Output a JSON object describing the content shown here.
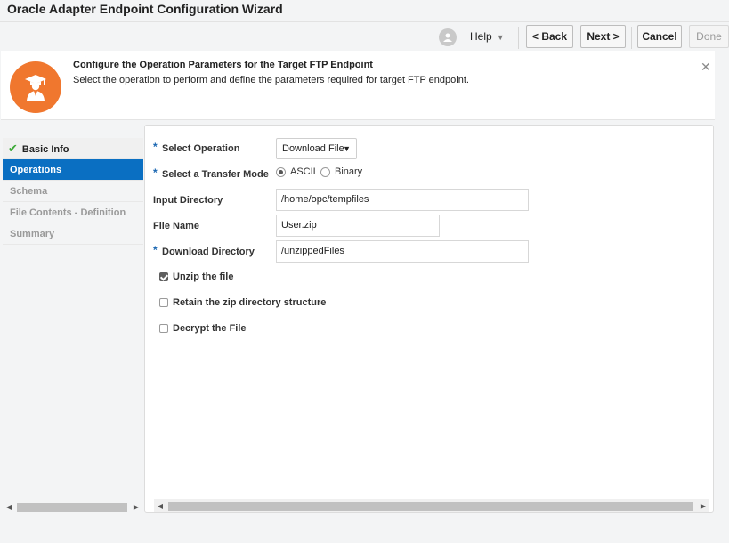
{
  "window": {
    "title": "Oracle Adapter Endpoint Configuration Wizard"
  },
  "toolbar": {
    "help_label": "Help",
    "back_label": "< Back",
    "next_label": "Next >",
    "cancel_label": "Cancel",
    "done_label": "Done",
    "user_avatar_icon": "user-badge-icon"
  },
  "banner": {
    "title": "Configure the Operation Parameters for the Target FTP Endpoint",
    "subtitle": "Select the operation to perform and define the parameters required for target FTP endpoint.",
    "icon": "graduate-user-icon",
    "icon_color": "#f0772e"
  },
  "nav": {
    "items": [
      {
        "label": "Basic Info",
        "state": "done"
      },
      {
        "label": "Operations",
        "state": "active"
      },
      {
        "label": "Schema",
        "state": "disabled"
      },
      {
        "label": "File Contents - Definition",
        "state": "disabled"
      },
      {
        "label": "Summary",
        "state": "disabled"
      }
    ],
    "active_color": "#0a6fc2"
  },
  "form": {
    "select_operation": {
      "label": "Select Operation",
      "value": "Download File",
      "required": true
    },
    "transfer_mode": {
      "label": "Select a Transfer Mode",
      "options": [
        "ASCII",
        "Binary"
      ],
      "selected": "ASCII",
      "required": true
    },
    "input_directory": {
      "label": "Input Directory",
      "value": "/home/opc/tempfiles"
    },
    "file_name": {
      "label": "File Name",
      "value": "User.zip"
    },
    "download_directory": {
      "label": "Download Directory",
      "value": "/unzippedFiles",
      "required": true
    },
    "checkboxes": [
      {
        "label": "Unzip the file",
        "checked": true
      },
      {
        "label": "Retain the zip directory structure",
        "checked": false
      },
      {
        "label": "Decrypt the File",
        "checked": false
      }
    ]
  }
}
